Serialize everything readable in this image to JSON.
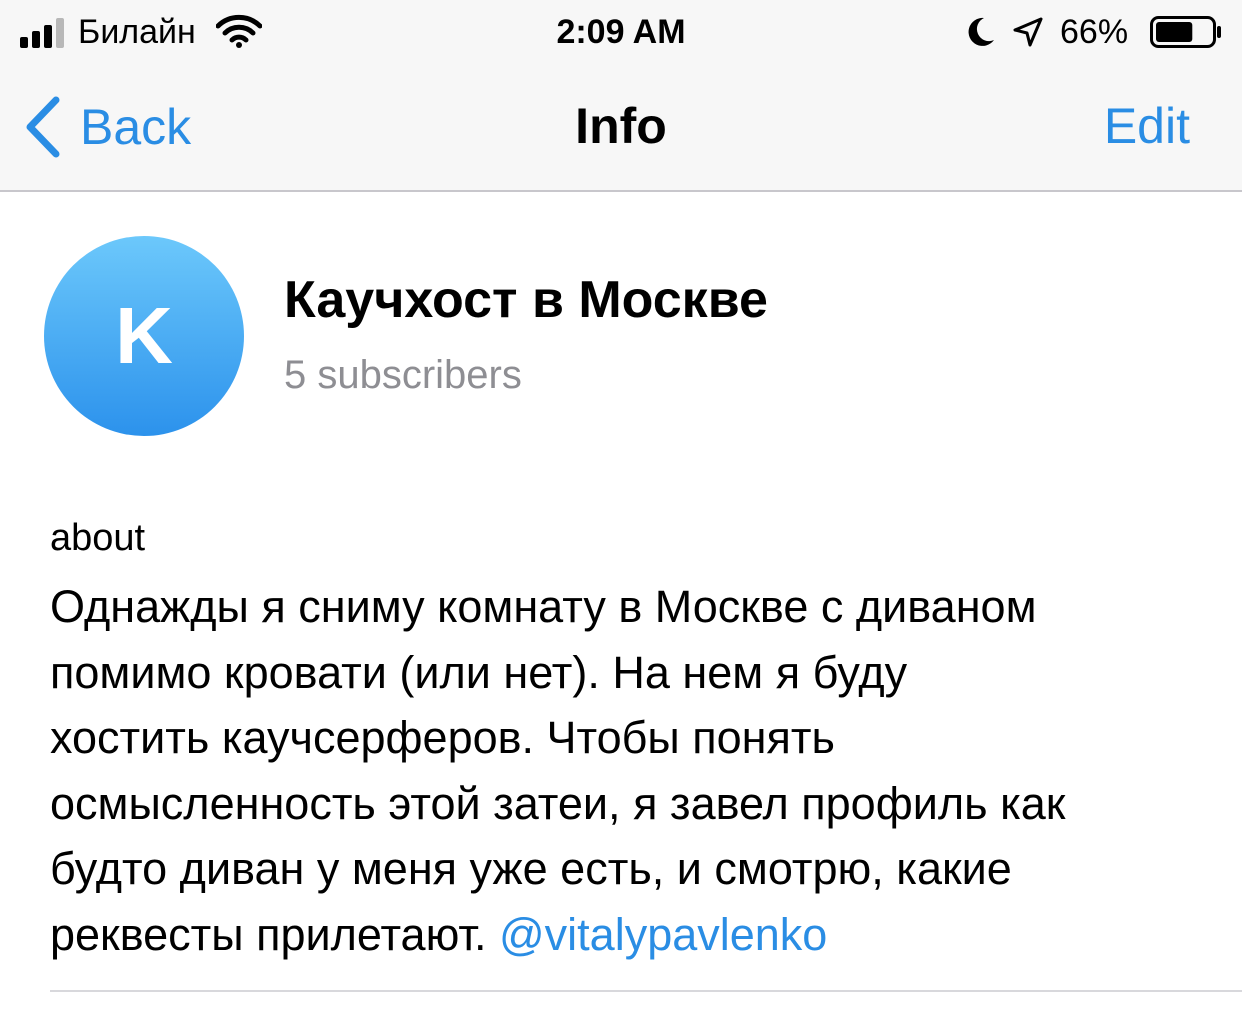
{
  "status_bar": {
    "carrier": "Билайн",
    "time": "2:09 AM",
    "battery_percent": "66%",
    "battery_level": 0.66,
    "icons": [
      "signal-icon",
      "wifi-icon",
      "moon-icon",
      "location-arrow-icon",
      "battery-icon"
    ]
  },
  "nav": {
    "back_label": "Back",
    "title": "Info",
    "edit_label": "Edit"
  },
  "profile": {
    "avatar_letter": "K",
    "name": "Каучхост в Москве",
    "subscribers": "5 subscribers"
  },
  "about": {
    "label": "about",
    "lines": [
      "Однажды я сниму комнату в Москве с диваном",
      "помимо кровати (или нет). На нем я буду",
      "хостить каучсерферов. Чтобы понять",
      "осмысленность этой затеи, я завел профиль как",
      "будто диван у меня уже есть, и смотрю, какие",
      "реквесты прилетают."
    ],
    "mention": "@vitalypavlenko"
  },
  "colors": {
    "accent": "#2a8de4",
    "secondary_text": "#8e8e93",
    "bar_background": "#f7f7f7"
  }
}
